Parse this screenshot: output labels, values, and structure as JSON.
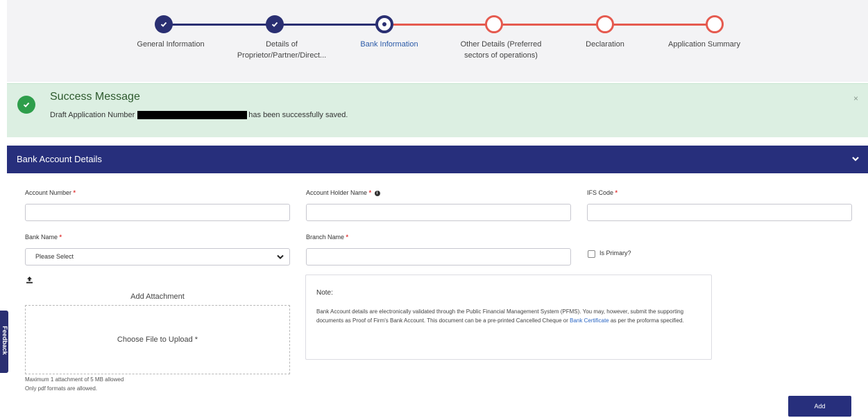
{
  "stepper": {
    "steps": [
      {
        "label": "General Information",
        "state": "done"
      },
      {
        "label": "Details of Proprietor/Partner/Direct...",
        "state": "done"
      },
      {
        "label": "Bank Information",
        "state": "current"
      },
      {
        "label": "Other Details (Preferred sectors of operations)",
        "state": "todo"
      },
      {
        "label": "Declaration",
        "state": "todo"
      },
      {
        "label": "Application Summary",
        "state": "todo"
      }
    ],
    "colors": {
      "done": "#2a2f72",
      "todo": "#e55a4f"
    }
  },
  "alert": {
    "title": "Success Message",
    "text_before": "Draft Application Number",
    "text_after": "has been successfully saved.",
    "close": "×",
    "background": "#dcefe2",
    "icon": "check-circle-icon"
  },
  "section": {
    "title": "Bank Account Details",
    "icon": "chevron-down-icon",
    "background": "#272f7c"
  },
  "form": {
    "account_number": {
      "label": "Account Number",
      "required": "*",
      "value": ""
    },
    "account_holder_name": {
      "label": "Account Holder Name",
      "required": "*",
      "info": "i",
      "value": ""
    },
    "ifs_code": {
      "label": "IFS Code",
      "required": "*",
      "value": ""
    },
    "bank_name": {
      "label": "Bank Name",
      "required": "*",
      "selected": "Please Select"
    },
    "branch_name": {
      "label": "Branch Name",
      "required": "*",
      "value": ""
    },
    "is_primary": {
      "label": "Is Primary?",
      "checked": false
    }
  },
  "attachment": {
    "title": "Add Attachment",
    "dropzone_text": "Choose File to Upload *",
    "help_line1": "Maximum 1 attachment of 5 MB allowed",
    "help_line2": "Only pdf formats are allowed.",
    "icon": "upload-icon"
  },
  "note": {
    "title": "Note:",
    "text_part1": "Bank Account details are electronically validated through the Public Financial Management System (PFMS). You may, however, submit the supporting documents as Proof of Firm's Bank Account. This document can be a pre-printed Cancelled Cheque or ",
    "link_text": "Bank Certificate",
    "text_part2": " as per the proforma specified."
  },
  "feedback": {
    "label": "Feedback"
  },
  "buttons": {
    "add": "Add"
  }
}
